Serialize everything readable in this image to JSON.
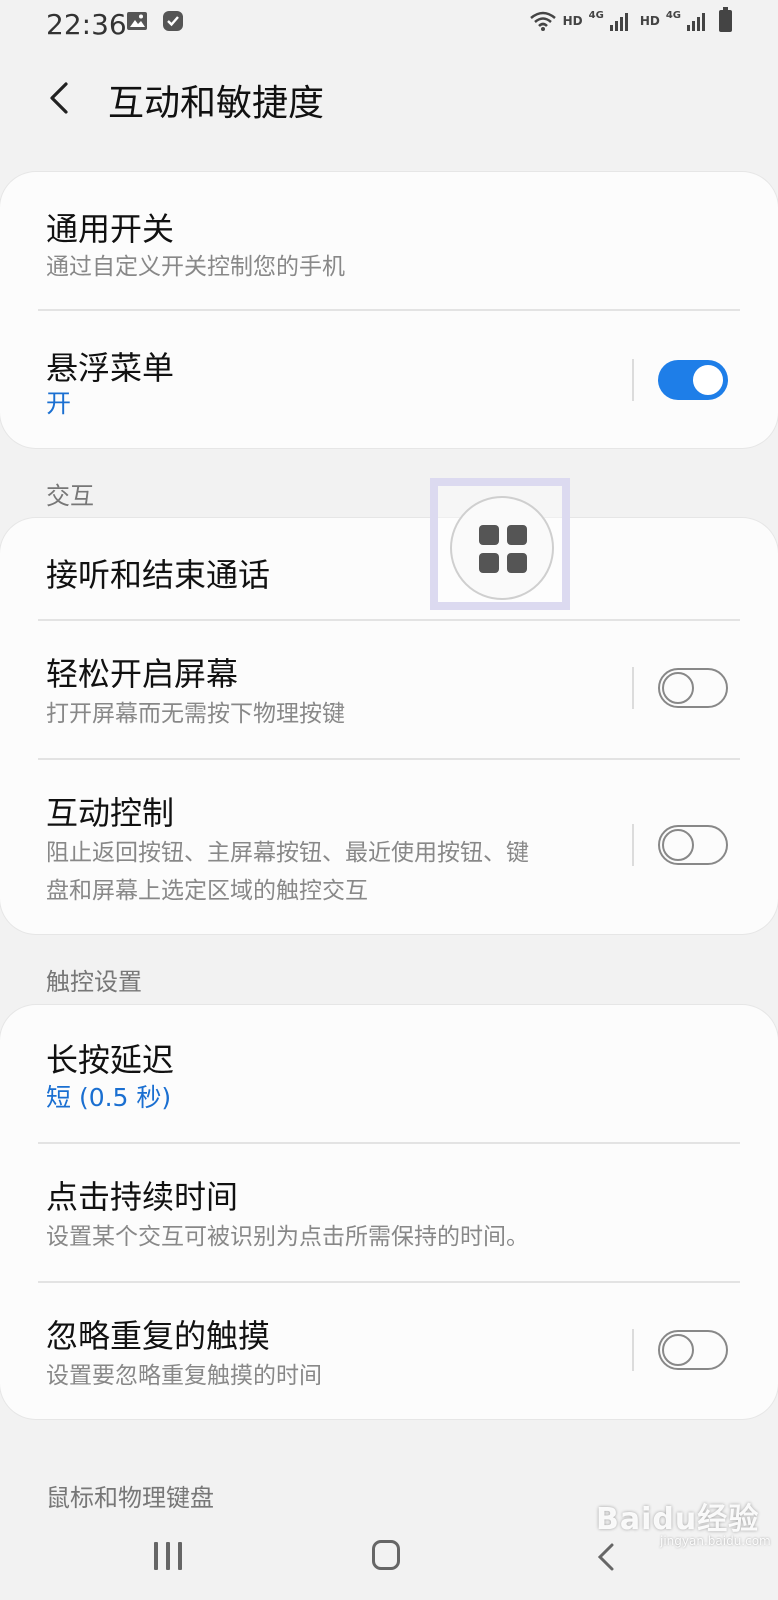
{
  "status_bar": {
    "time": "22:36",
    "left_icons": [
      "image-icon",
      "check-badge-icon"
    ],
    "right_icons": [
      "wifi-icon",
      "signal-icon",
      "signal-icon",
      "battery-icon"
    ],
    "hd_label": "HD",
    "net_label": "4G"
  },
  "header": {
    "title": "互动和敏捷度",
    "back_icon": "chevron-left-icon"
  },
  "card1": {
    "universal_switch": {
      "title": "通用开关",
      "subtitle": "通过自定义开关控制您的手机"
    },
    "assistant_menu": {
      "title": "悬浮菜单",
      "status": "开",
      "toggle_on": true
    }
  },
  "sections": {
    "interaction": "交互",
    "touch_settings": "触控设置",
    "mouse_keyboard": "鼠标和物理键盘"
  },
  "card2": {
    "answer_end_calls": {
      "title": "接听和结束通话"
    },
    "easy_screen_on": {
      "title": "轻松开启屏幕",
      "subtitle": "打开屏幕而无需按下物理按键",
      "toggle_on": false
    },
    "interaction_control": {
      "title": "互动控制",
      "subtitle_line1": "阻止返回按钮、主屏幕按钮、最近使用按钮、键",
      "subtitle_line2": "盘和屏幕上选定区域的触控交互",
      "toggle_on": false
    }
  },
  "card3": {
    "touch_hold_delay": {
      "title": "长按延迟",
      "value": "短 (0.5 秒)"
    },
    "tap_duration": {
      "title": "点击持续时间",
      "subtitle": "设置某个交互可被识别为点击所需保持的时间。"
    },
    "ignore_repeated_touches": {
      "title": "忽略重复的触摸",
      "subtitle": "设置要忽略重复触摸的时间",
      "toggle_on": false
    }
  },
  "floating_button": {
    "icon": "apps-grid-icon"
  },
  "nav_bar": {
    "icons": [
      "recents-icon",
      "home-icon",
      "back-icon"
    ]
  },
  "watermark": {
    "text": "Baidu经验",
    "sub": "jingyan.baidu.com"
  },
  "colors": {
    "accent": "#1e7ee8",
    "link": "#1a6fd1",
    "background": "#f2f2f2"
  }
}
